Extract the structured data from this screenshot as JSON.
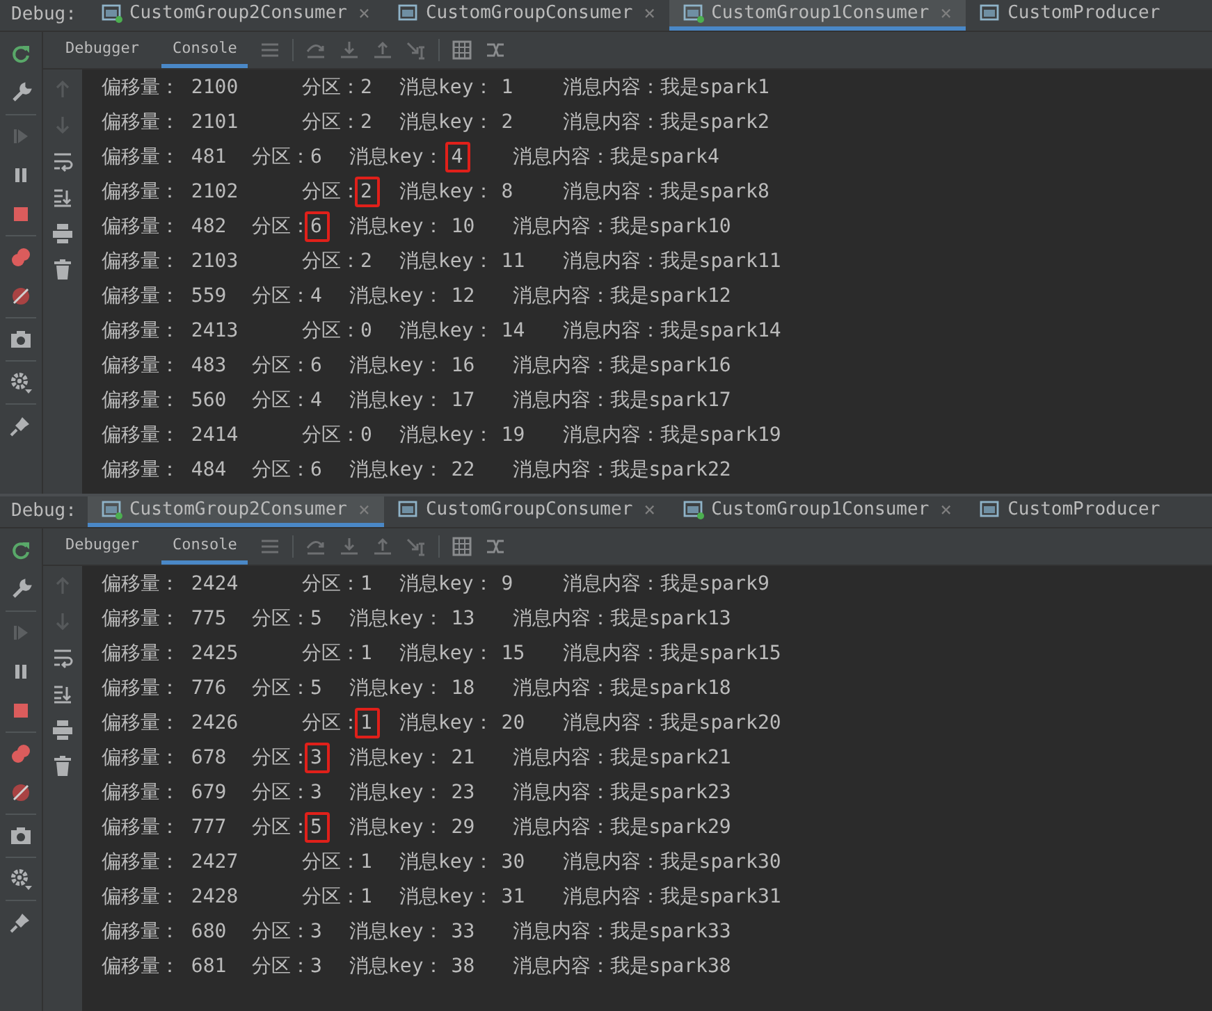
{
  "panels": [
    {
      "debug_label": "Debug:",
      "tabs": [
        {
          "label": "CustomGroup2Consumer",
          "selected": false,
          "running": true,
          "close": "×"
        },
        {
          "label": "CustomGroupConsumer",
          "selected": false,
          "running": false,
          "close": "×"
        },
        {
          "label": "CustomGroup1Consumer",
          "selected": true,
          "running": true,
          "close": "×"
        },
        {
          "label": "CustomProducer",
          "selected": false,
          "running": false
        }
      ],
      "subtabs": [
        {
          "label": "Debugger",
          "selected": false
        },
        {
          "label": "Console",
          "selected": true
        }
      ],
      "lines": [
        {
          "offset": "偏移量： 2100",
          "partition_label": "分区：",
          "partition": "2",
          "key_label": "消息key：",
          "key": "1",
          "content": "消息内容：我是spark1",
          "partition_boxed": false,
          "key_boxed": false
        },
        {
          "offset": "偏移量： 2101",
          "partition_label": "分区：",
          "partition": "2",
          "key_label": "消息key：",
          "key": "2",
          "content": "消息内容：我是spark2",
          "partition_boxed": false,
          "key_boxed": false
        },
        {
          "offset": "偏移量： 481",
          "partition_label": "分区：",
          "partition": "6",
          "key_label": "消息key：",
          "key": "4",
          "content": "消息内容：我是spark4",
          "partition_boxed": false,
          "key_boxed": true
        },
        {
          "offset": "偏移量： 2102",
          "partition_label": "分区：",
          "partition": "2",
          "key_label": "消息key：",
          "key": "8",
          "content": "消息内容：我是spark8",
          "partition_boxed": true,
          "key_boxed": false
        },
        {
          "offset": "偏移量： 482",
          "partition_label": "分区：",
          "partition": "6",
          "key_label": "消息key：",
          "key": "10",
          "content": "消息内容：我是spark10",
          "partition_boxed": true,
          "key_boxed": false
        },
        {
          "offset": "偏移量： 2103",
          "partition_label": "分区：",
          "partition": "2",
          "key_label": "消息key：",
          "key": "11",
          "content": "消息内容：我是spark11",
          "partition_boxed": false,
          "key_boxed": false
        },
        {
          "offset": "偏移量： 559",
          "partition_label": "分区：",
          "partition": "4",
          "key_label": "消息key：",
          "key": "12",
          "content": "消息内容：我是spark12",
          "partition_boxed": false,
          "key_boxed": false
        },
        {
          "offset": "偏移量： 2413",
          "partition_label": "分区：",
          "partition": "0",
          "key_label": "消息key：",
          "key": "14",
          "content": "消息内容：我是spark14",
          "partition_boxed": false,
          "key_boxed": false
        },
        {
          "offset": "偏移量： 483",
          "partition_label": "分区：",
          "partition": "6",
          "key_label": "消息key：",
          "key": "16",
          "content": "消息内容：我是spark16",
          "partition_boxed": false,
          "key_boxed": false
        },
        {
          "offset": "偏移量： 560",
          "partition_label": "分区：",
          "partition": "4",
          "key_label": "消息key：",
          "key": "17",
          "content": "消息内容：我是spark17",
          "partition_boxed": false,
          "key_boxed": false
        },
        {
          "offset": "偏移量： 2414",
          "partition_label": "分区：",
          "partition": "0",
          "key_label": "消息key：",
          "key": "19",
          "content": "消息内容：我是spark19",
          "partition_boxed": false,
          "key_boxed": false
        },
        {
          "offset": "偏移量： 484",
          "partition_label": "分区：",
          "partition": "6",
          "key_label": "消息key：",
          "key": "22",
          "content": "消息内容：我是spark22",
          "partition_boxed": false,
          "key_boxed": false
        }
      ]
    },
    {
      "debug_label": "Debug:",
      "tabs": [
        {
          "label": "CustomGroup2Consumer",
          "selected": true,
          "running": true,
          "close": "×"
        },
        {
          "label": "CustomGroupConsumer",
          "selected": false,
          "running": false,
          "close": "×"
        },
        {
          "label": "CustomGroup1Consumer",
          "selected": false,
          "running": true,
          "close": "×"
        },
        {
          "label": "CustomProducer",
          "selected": false,
          "running": false
        }
      ],
      "subtabs": [
        {
          "label": "Debugger",
          "selected": false
        },
        {
          "label": "Console",
          "selected": true
        }
      ],
      "lines": [
        {
          "offset": "偏移量： 2424",
          "partition_label": "分区：",
          "partition": "1",
          "key_label": "消息key：",
          "key": "9",
          "content": "消息内容：我是spark9",
          "partition_boxed": false,
          "key_boxed": false
        },
        {
          "offset": "偏移量： 775",
          "partition_label": "分区：",
          "partition": "5",
          "key_label": "消息key：",
          "key": "13",
          "content": "消息内容：我是spark13",
          "partition_boxed": false,
          "key_boxed": false
        },
        {
          "offset": "偏移量： 2425",
          "partition_label": "分区：",
          "partition": "1",
          "key_label": "消息key：",
          "key": "15",
          "content": "消息内容：我是spark15",
          "partition_boxed": false,
          "key_boxed": false
        },
        {
          "offset": "偏移量： 776",
          "partition_label": "分区：",
          "partition": "5",
          "key_label": "消息key：",
          "key": "18",
          "content": "消息内容：我是spark18",
          "partition_boxed": false,
          "key_boxed": false
        },
        {
          "offset": "偏移量： 2426",
          "partition_label": "分区：",
          "partition": "1",
          "key_label": "消息key：",
          "key": "20",
          "content": "消息内容：我是spark20",
          "partition_boxed": true,
          "key_boxed": false
        },
        {
          "offset": "偏移量： 678",
          "partition_label": "分区：",
          "partition": "3",
          "key_label": "消息key：",
          "key": "21",
          "content": "消息内容：我是spark21",
          "partition_boxed": true,
          "key_boxed": false
        },
        {
          "offset": "偏移量： 679",
          "partition_label": "分区：",
          "partition": "3",
          "key_label": "消息key：",
          "key": "23",
          "content": "消息内容：我是spark23",
          "partition_boxed": false,
          "key_boxed": false
        },
        {
          "offset": "偏移量： 777",
          "partition_label": "分区：",
          "partition": "5",
          "key_label": "消息key：",
          "key": "29",
          "content": "消息内容：我是spark29",
          "partition_boxed": true,
          "key_boxed": false
        },
        {
          "offset": "偏移量： 2427",
          "partition_label": "分区：",
          "partition": "1",
          "key_label": "消息key：",
          "key": "30",
          "content": "消息内容：我是spark30",
          "partition_boxed": false,
          "key_boxed": false
        },
        {
          "offset": "偏移量： 2428",
          "partition_label": "分区：",
          "partition": "1",
          "key_label": "消息key：",
          "key": "31",
          "content": "消息内容：我是spark31",
          "partition_boxed": false,
          "key_boxed": false
        },
        {
          "offset": "偏移量： 680",
          "partition_label": "分区：",
          "partition": "3",
          "key_label": "消息key：",
          "key": "33",
          "content": "消息内容：我是spark33",
          "partition_boxed": false,
          "key_boxed": false
        },
        {
          "offset": "偏移量： 681",
          "partition_label": "分区：",
          "partition": "3",
          "key_label": "消息key：",
          "key": "38",
          "content": "消息内容：我是spark38",
          "partition_boxed": false,
          "key_boxed": false
        }
      ]
    }
  ]
}
